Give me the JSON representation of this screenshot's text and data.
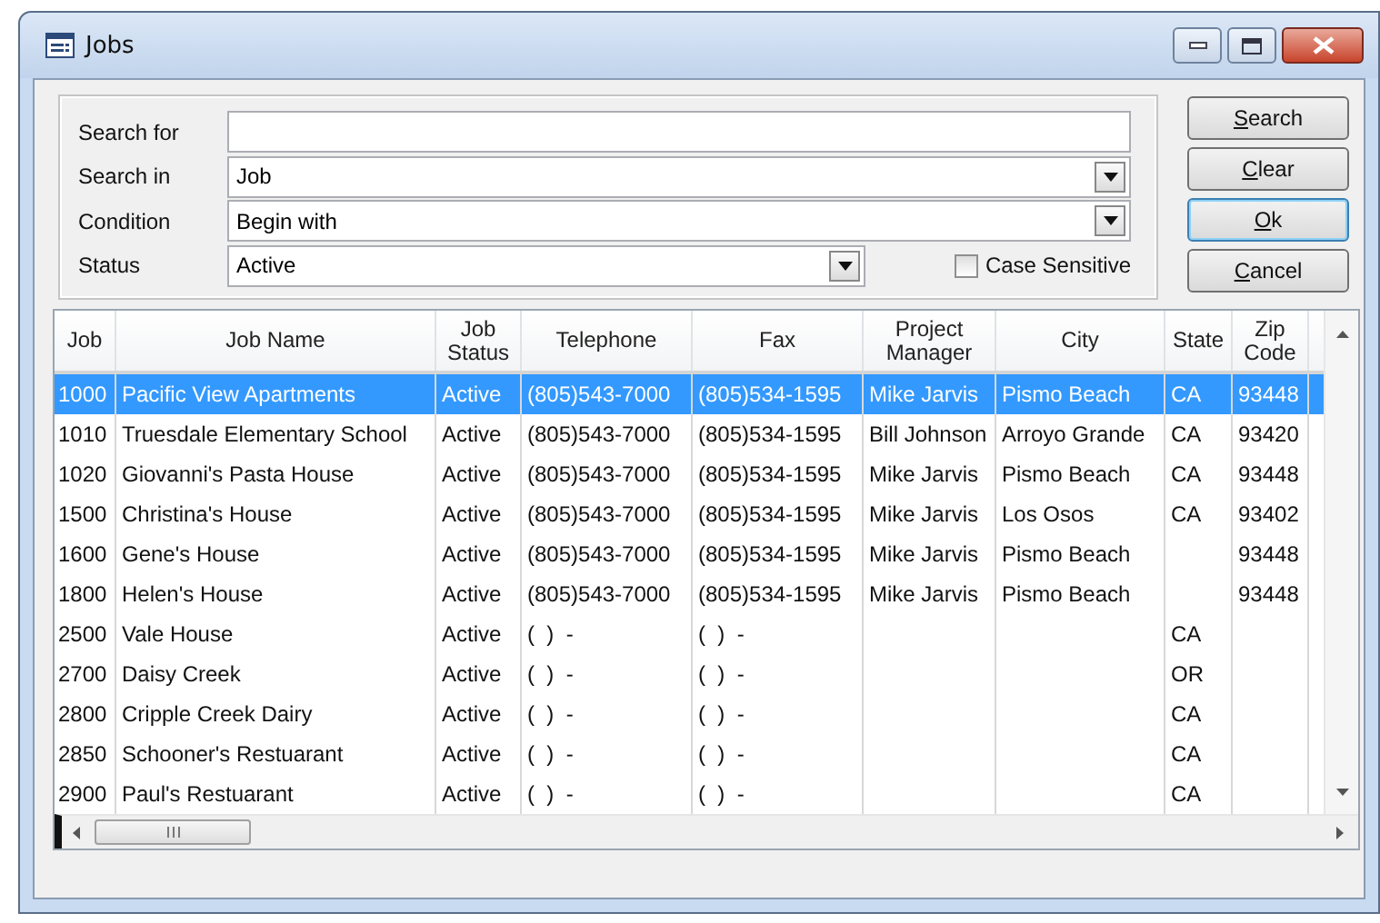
{
  "window": {
    "title": "Jobs"
  },
  "search": {
    "fields": [
      {
        "kind": "text",
        "label": "Search for"
      },
      {
        "kind": "dropdown",
        "label": "Search in",
        "value": "Job"
      },
      {
        "kind": "dropdown",
        "label": "Condition",
        "value": "Begin with"
      },
      {
        "kind": "dropdown",
        "label": "Status",
        "value": "Active"
      }
    ],
    "case_sensitive": {
      "label": "Case Sensitive",
      "checked": false
    }
  },
  "buttons": [
    {
      "label": "Search",
      "focused": false
    },
    {
      "label": "Clear",
      "focused": false
    },
    {
      "label": "Ok",
      "focused": true
    },
    {
      "label": "Cancel",
      "focused": false
    }
  ],
  "table": {
    "columns": [
      "Job",
      "Job Name",
      "Job Status",
      "Telephone",
      "Fax",
      "Project Manager",
      "City",
      "State",
      "Zip Code"
    ],
    "rows": [
      {
        "selected": true,
        "cells": [
          "1000",
          "Pacific View Apartments",
          "Active",
          "(805)543-7000",
          "(805)534-1595",
          "Mike Jarvis",
          "Pismo Beach",
          "CA",
          "93448"
        ]
      },
      {
        "selected": false,
        "cells": [
          "1010",
          "Truesdale Elementary School",
          "Active",
          "(805)543-7000",
          "(805)534-1595",
          "Bill Johnson",
          "Arroyo Grande",
          "CA",
          "93420"
        ]
      },
      {
        "selected": false,
        "cells": [
          "1020",
          "Giovanni's Pasta House",
          "Active",
          "(805)543-7000",
          "(805)534-1595",
          "Mike Jarvis",
          "Pismo Beach",
          "CA",
          "93448"
        ]
      },
      {
        "selected": false,
        "cells": [
          "1500",
          "Christina's House",
          "Active",
          "(805)543-7000",
          "(805)534-1595",
          "Mike Jarvis",
          "Los Osos",
          "CA",
          "93402"
        ]
      },
      {
        "selected": false,
        "cells": [
          "1600",
          "Gene's House",
          "Active",
          "(805)543-7000",
          "(805)534-1595",
          "Mike Jarvis",
          "Pismo Beach",
          null,
          "93448"
        ]
      },
      {
        "selected": false,
        "cells": [
          "1800",
          "Helen's House",
          "Active",
          "(805)543-7000",
          "(805)534-1595",
          "Mike Jarvis",
          "Pismo Beach",
          null,
          "93448"
        ]
      },
      {
        "selected": false,
        "cells": [
          "2500",
          "Vale House",
          "Active",
          "(  )  -",
          "(  )  -",
          null,
          null,
          "CA",
          null
        ]
      },
      {
        "selected": false,
        "cells": [
          "2700",
          "Daisy Creek",
          "Active",
          "(  )  -",
          "(  )  -",
          null,
          null,
          "OR",
          null
        ]
      },
      {
        "selected": false,
        "cells": [
          "2800",
          "Cripple Creek Dairy",
          "Active",
          "(  )  -",
          "(  )  -",
          null,
          null,
          "CA",
          null
        ]
      },
      {
        "selected": false,
        "cells": [
          "2850",
          "Schooner's Restuarant",
          "Active",
          "(  )  -",
          "(  )  -",
          null,
          null,
          "CA",
          null
        ]
      },
      {
        "selected": false,
        "cells": [
          "2900",
          "Paul's Restuarant",
          "Active",
          "(  )  -",
          "(  )  -",
          null,
          null,
          "CA",
          null
        ]
      }
    ]
  }
}
